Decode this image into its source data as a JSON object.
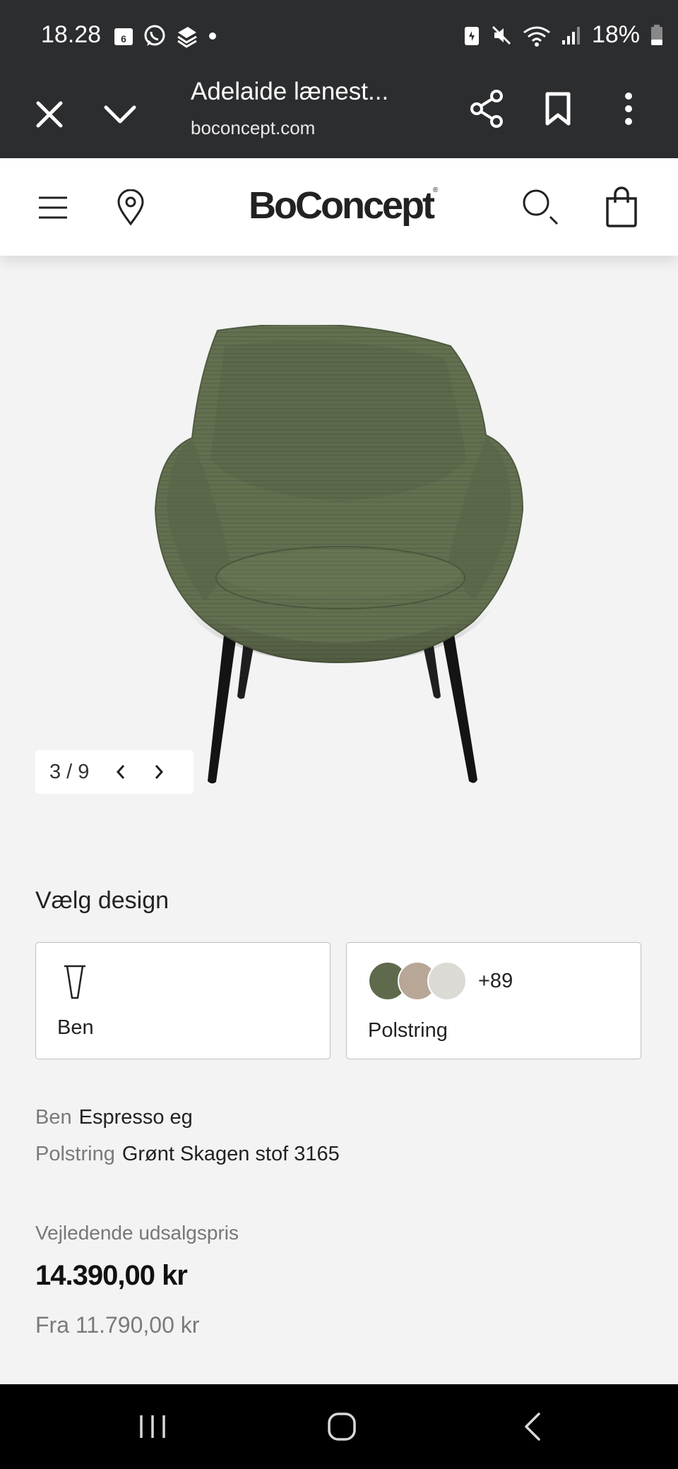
{
  "status_bar": {
    "time": "18.28",
    "calendar_day": "6",
    "battery": "18%"
  },
  "browser": {
    "title": "Adelaide lænest...",
    "url": "boconcept.com"
  },
  "site": {
    "logo": "BoConcept",
    "logo_mark": "®"
  },
  "gallery": {
    "counter": "3 / 9"
  },
  "design": {
    "title": "Vælg design",
    "ben_label": "Ben",
    "polstring_label": "Polstring",
    "more_count": "+89",
    "swatch_colors": [
      "#5f6a4c",
      "#b8a697",
      "#dcdad4"
    ]
  },
  "specs": {
    "ben_key": "Ben",
    "ben_value": "Espresso eg",
    "polstring_key": "Polstring",
    "polstring_value": "Grønt Skagen stof 3165"
  },
  "pricing": {
    "note": "Vejledende udsalgspris",
    "price": "14.390,00 kr",
    "from": "Fra 11.790,00 kr"
  },
  "colors": {
    "chrome": "#2c2d2f",
    "chair_green": "#63704f",
    "page_bg": "#f3f3f3"
  }
}
